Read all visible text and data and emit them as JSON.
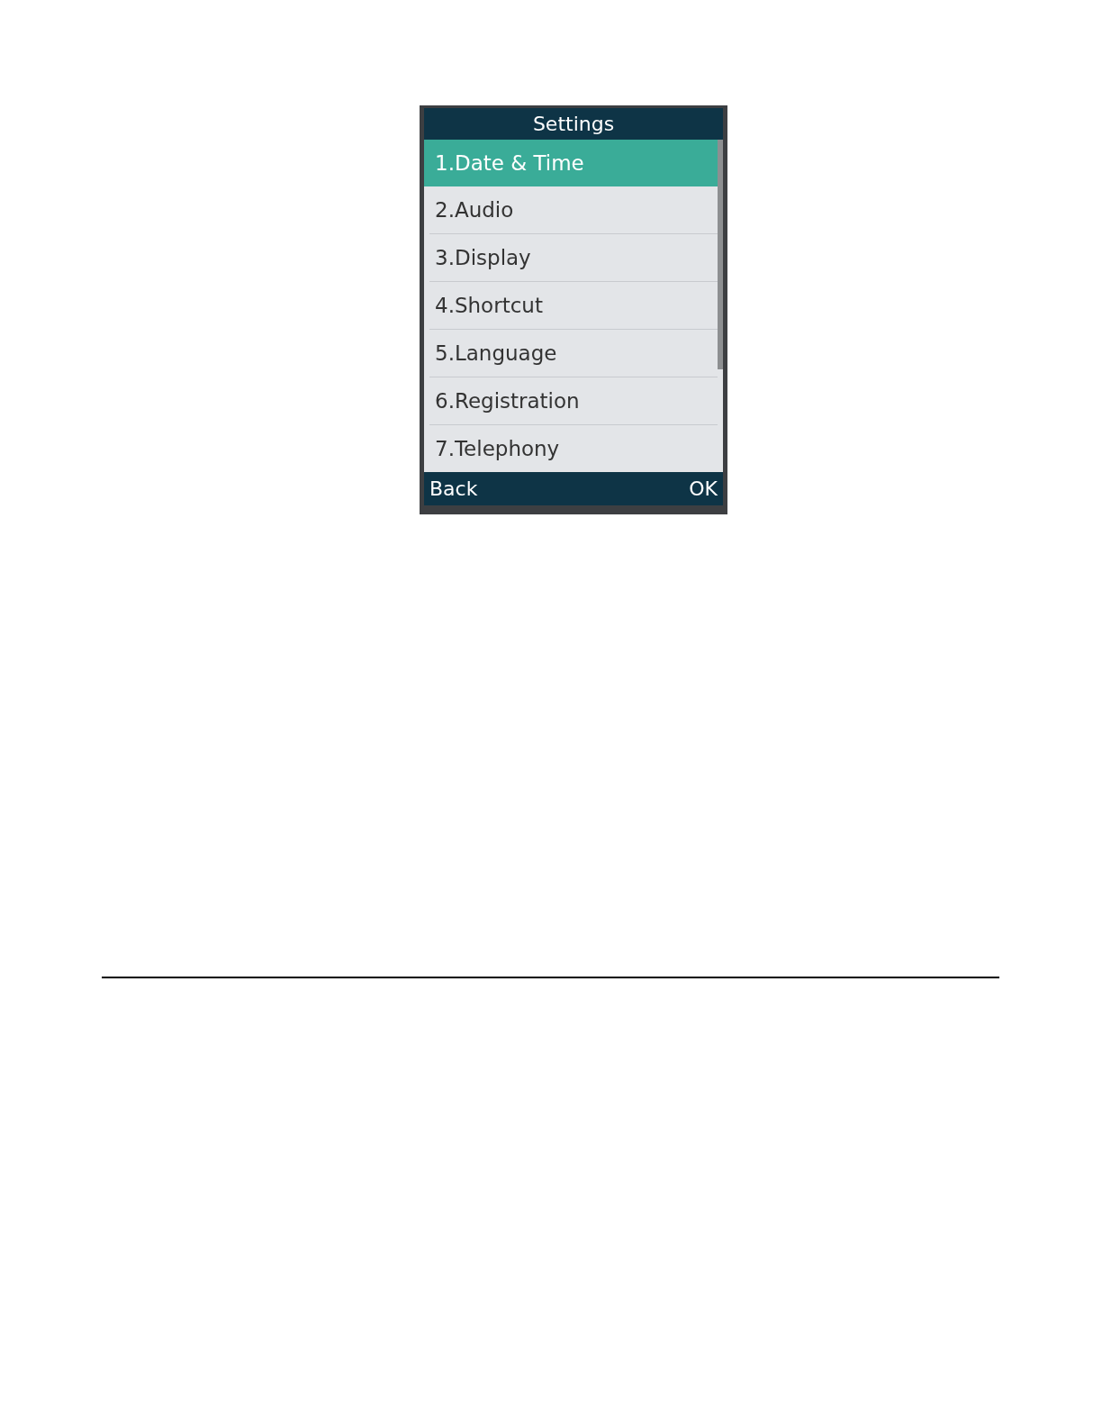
{
  "screen": {
    "title": "Settings",
    "menu_items": [
      {
        "label": "1.Date & Time",
        "selected": true
      },
      {
        "label": "2.Audio",
        "selected": false
      },
      {
        "label": "3.Display",
        "selected": false
      },
      {
        "label": "4.Shortcut",
        "selected": false
      },
      {
        "label": "5.Language",
        "selected": false
      },
      {
        "label": "6.Registration",
        "selected": false
      },
      {
        "label": "7.Telephony",
        "selected": false
      }
    ],
    "softkeys": {
      "left": "Back",
      "right": "OK"
    }
  }
}
